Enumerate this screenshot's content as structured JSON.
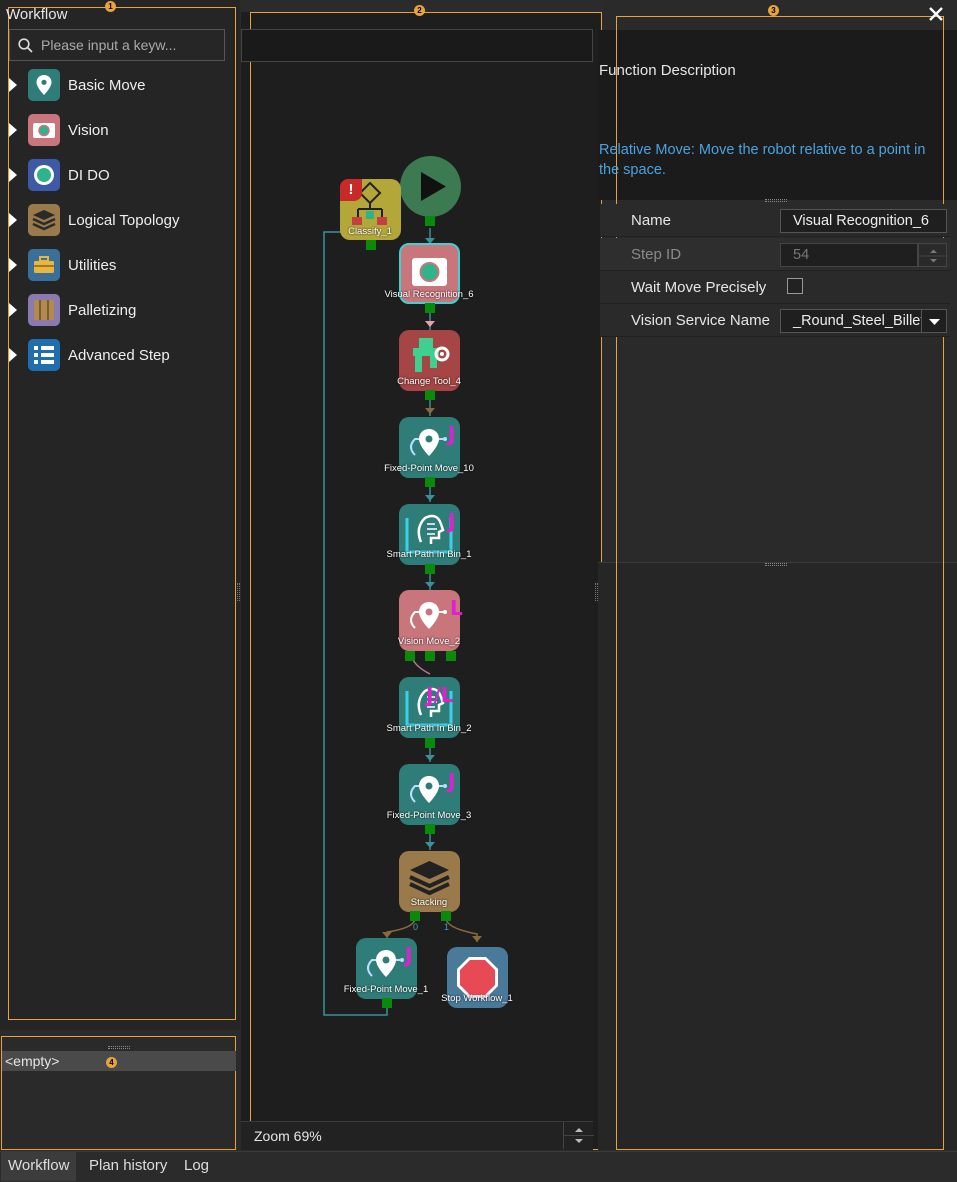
{
  "left_panel": {
    "title": "Workflow",
    "search_placeholder": "Please input a keyw...",
    "categories": [
      {
        "label": "Basic Move",
        "icon": "location-pin-icon",
        "color": "#2f7d78"
      },
      {
        "label": "Vision",
        "icon": "camera-icon",
        "color": "#c9757c"
      },
      {
        "label": "DI DO",
        "icon": "io-ring-icon",
        "color": "#3d5aa6"
      },
      {
        "label": "Logical Topology",
        "icon": "layers-icon",
        "color": "#9a7a4a"
      },
      {
        "label": "Utilities",
        "icon": "toolbox-icon",
        "color": "#3a6f9a"
      },
      {
        "label": "Palletizing",
        "icon": "pallet-icon",
        "color": "#8a7ab0"
      },
      {
        "label": "Advanced Step",
        "icon": "advanced-step-icon",
        "color": "#1f6fb0"
      }
    ],
    "empty_item": "<empty>"
  },
  "badges": [
    "1",
    "2",
    "3",
    "4"
  ],
  "canvas": {
    "zoom": "Zoom 69%",
    "nodes": [
      {
        "label": "Classify_1",
        "icon": "classify-icon",
        "color": "#b4a73a"
      },
      {
        "label": "Visual Recognition_6",
        "icon": "camera-icon",
        "color": "#c9757c"
      },
      {
        "label": "Change Tool_4",
        "icon": "change-tool-icon",
        "color": "#a54545"
      },
      {
        "label": "Fixed-Point Move_10",
        "icon": "location-pin-icon",
        "color": "#2f7d78",
        "mode": "J"
      },
      {
        "label": "Smart Path In Bin_1",
        "icon": "smart-path-icon",
        "color": "#2f7d78",
        "mode": "J"
      },
      {
        "label": "Vision Move_2",
        "icon": "location-pin-icon",
        "color": "#c9757c",
        "mode": "L"
      },
      {
        "label": "Smart Path In Bin_2",
        "icon": "smart-path-icon",
        "color": "#2f7d78",
        "mode": "J/L"
      },
      {
        "label": "Fixed-Point Move_3",
        "icon": "location-pin-icon",
        "color": "#2f7d78",
        "mode": "J"
      },
      {
        "label": "Stacking",
        "icon": "layers-icon",
        "color": "#9a7a4a"
      },
      {
        "label": "Fixed-Point Move_1",
        "icon": "location-pin-icon",
        "color": "#2f7d78",
        "mode": "J"
      },
      {
        "label": "Stop Workflow_1",
        "icon": "stop-icon",
        "color": "#4a7a9a"
      }
    ],
    "port_labels": [
      "0",
      "1"
    ]
  },
  "right_panel": {
    "function_title": "Function Description",
    "description": "Relative Move: Move the robot relative to a point in the space.",
    "properties": {
      "name_label": "Name",
      "name_value": "Visual Recognition_6",
      "step_id_label": "Step ID",
      "step_id_value": "54",
      "wait_label": "Wait Move Precisely",
      "vision_label": "Vision Service Name",
      "vision_value": "_Round_Steel_Billet"
    }
  },
  "tabs": [
    {
      "label": "Workflow",
      "active": true
    },
    {
      "label": "Plan history",
      "active": false
    },
    {
      "label": "Log",
      "active": false
    }
  ]
}
